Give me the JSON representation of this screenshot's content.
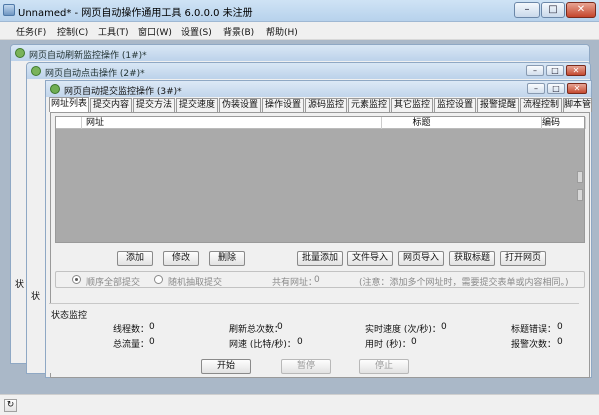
{
  "app": {
    "title": "Unnamed* - 网页自动操作通用工具 6.0.0.0 未注册"
  },
  "menu": [
    "任务(F)",
    "控制(C)",
    "工具(T)",
    "窗口(W)",
    "设置(S)",
    "背景(B)",
    "帮助(H)"
  ],
  "windows": {
    "bg1": {
      "title": "网页自动刷新监控操作 (1#)*",
      "side_label": "状"
    },
    "bg2": {
      "title": "网页自动点击操作 (2#)*",
      "side_label": "状"
    },
    "main": {
      "title": "网页自动提交监控操作 (3#)*"
    }
  },
  "tabs": [
    "网址列表",
    "提交内容",
    "提交方法",
    "提交速度",
    "伪装设置",
    "操作设置",
    "源码监控",
    "元素监控",
    "其它监控",
    "监控设置",
    "报警提醒",
    "流程控制",
    "脚本管"
  ],
  "grid": {
    "columns": [
      "网址",
      "标题",
      "编码"
    ]
  },
  "buttons": {
    "add": "添加",
    "edit": "修改",
    "delete": "删除",
    "batch_add": "批量添加",
    "file_import": "文件导入",
    "web_import": "网页导入",
    "get_title": "获取标题",
    "open_page": "打开网页"
  },
  "options": {
    "sequential": "顺序全部提交",
    "random": "随机抽取提交",
    "total_urls_label": "共有网址：",
    "total_urls_value": "0",
    "note": "(注意：添加多个网址时，需要提交表单或内容相同。)"
  },
  "status": {
    "section_title": "状态监控",
    "threads_label": "线程数：",
    "threads_value": "0",
    "refresh_label": "刷新总次数：",
    "refresh_value": "0",
    "speed_label": "实时速度 (次/秒)：",
    "speed_value": "0",
    "errors_label": "标题错误：",
    "errors_value": "0",
    "traffic_label": "总流量：",
    "traffic_value": "0",
    "netspeed_label": "网速 (比特/秒)：",
    "netspeed_value": "0",
    "time_label": "用时 (秒)：",
    "time_value": "0",
    "alarm_label": "报警次数：",
    "alarm_value": "0"
  },
  "control": {
    "start": "开始",
    "pause": "暂停",
    "stop": "停止"
  },
  "colors": {
    "accent": "#c1d5eb",
    "grid_bg": "#aaaaaa",
    "workspace": "#aab8c8"
  }
}
